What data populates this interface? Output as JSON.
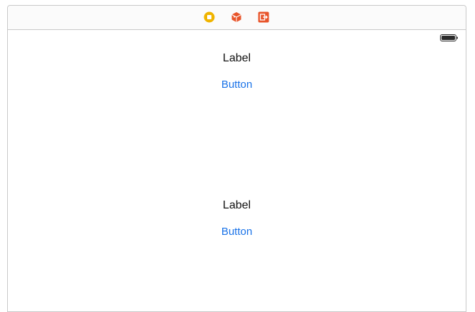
{
  "scene_dock": {
    "icons": [
      "view-controller-icon",
      "first-responder-icon",
      "exit-icon"
    ]
  },
  "status_bar": {
    "icon": "battery-icon"
  },
  "view": {
    "top_label": "Label",
    "top_button": "Button",
    "bottom_label": "Label",
    "bottom_button": "Button"
  },
  "colors": {
    "view_controller": "#f0b400",
    "first_responder": "#e8552b",
    "exit": "#e8552b",
    "button_text": "#1a73e8"
  }
}
